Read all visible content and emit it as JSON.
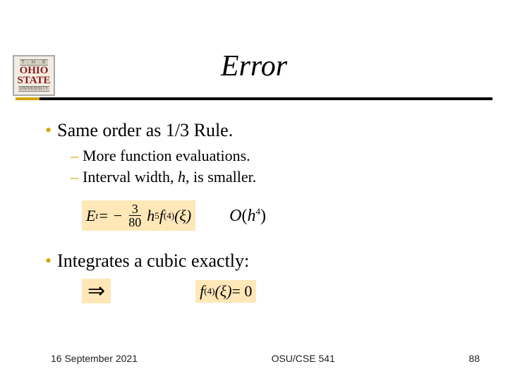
{
  "logo": {
    "top": "T · H · E",
    "mid_line1": "OHIO",
    "mid_line2": "STATE",
    "bot": "UNIVERSITY"
  },
  "title": "Error",
  "bullets": {
    "b1": "Same order as 1/3 Rule.",
    "b1a_pre": "More function evaluations.",
    "b1b_pre": "Interval width, ",
    "b1b_ital": "h",
    "b1b_post": ", is smaller.",
    "b2": "Integrates a cubic exactly:"
  },
  "formula1": {
    "lhs": "E",
    "lhs_sub": "t",
    "eq": " = −",
    "num": "3",
    "den": "80",
    "h": "h",
    "h_sup": "5",
    "f": "f",
    "f_sup": "(4)",
    "open": "(",
    "xi": "ξ",
    "close": ")"
  },
  "orderO": {
    "O": "O",
    "open": "(",
    "h": "h",
    "sup": "4",
    "close": ")"
  },
  "implies": "⇒",
  "formula2": {
    "f": "f",
    "f_sup": "(4)",
    "open": "(",
    "xi": "ξ",
    "close": ")",
    "eq": "= 0"
  },
  "footer": {
    "date": "16 September 2021",
    "course": "OSU/CSE 541",
    "page": "88"
  }
}
